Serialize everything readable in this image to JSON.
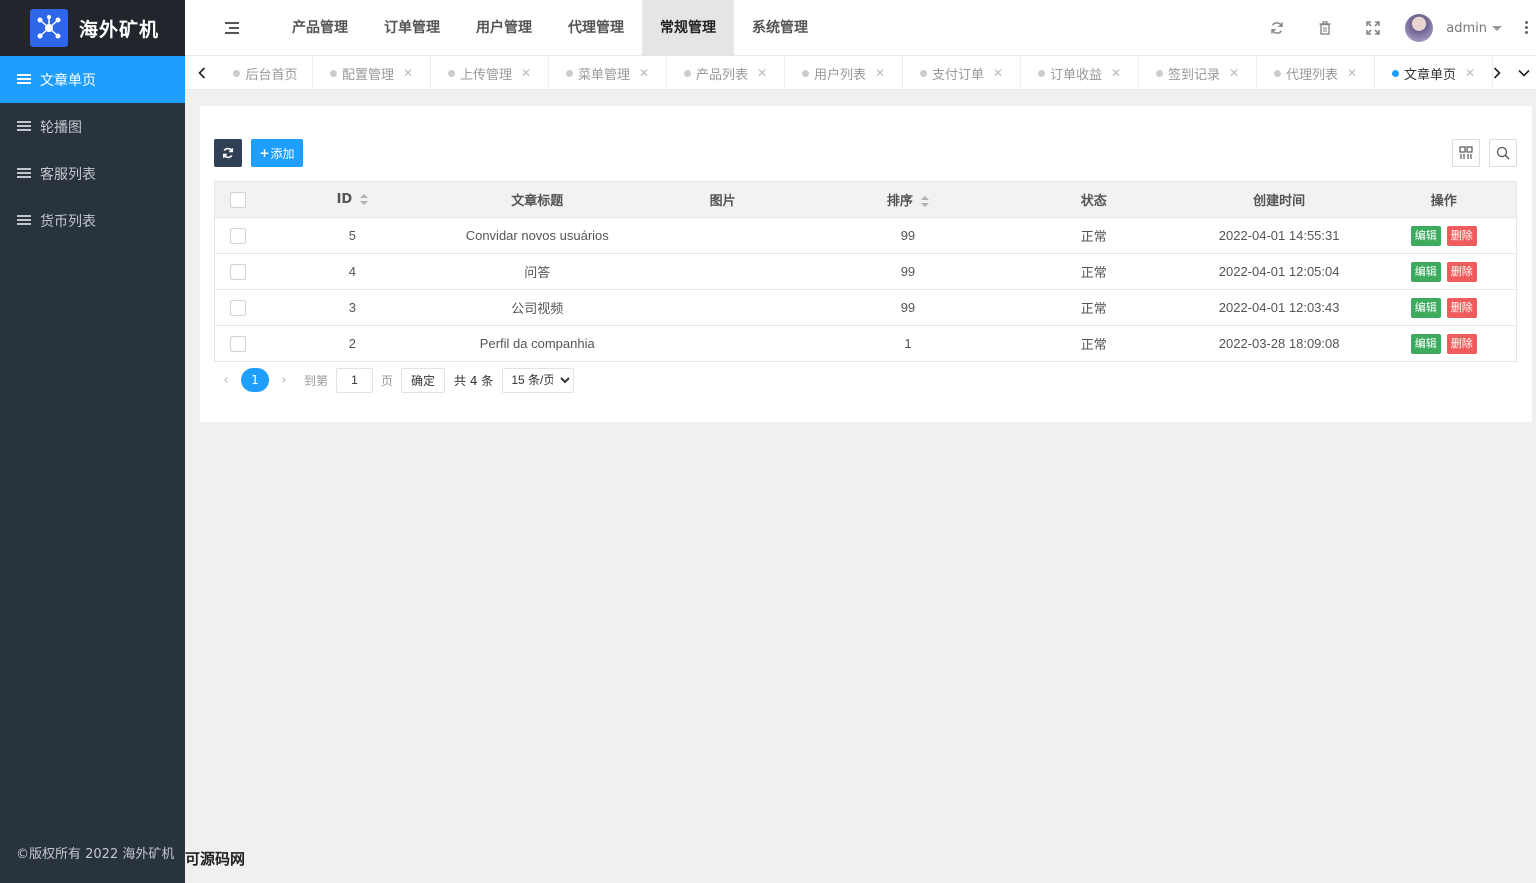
{
  "app": {
    "title": "海外矿机"
  },
  "sidebar": {
    "items": [
      {
        "label": "文章单页",
        "active": true
      },
      {
        "label": "轮播图"
      },
      {
        "label": "客服列表"
      },
      {
        "label": "货币列表"
      }
    ],
    "copyright": "©版权所有 2022 海外矿机"
  },
  "watermark": "可源码网",
  "header": {
    "nav": [
      {
        "label": "产品管理"
      },
      {
        "label": "订单管理"
      },
      {
        "label": "用户管理"
      },
      {
        "label": "代理管理"
      },
      {
        "label": "常规管理",
        "active": true
      },
      {
        "label": "系统管理"
      }
    ],
    "user": "admin",
    "icons": [
      "refresh-icon",
      "trash-icon",
      "fullscreen-icon"
    ]
  },
  "tabs": [
    {
      "label": "后台首页"
    },
    {
      "label": "配置管理"
    },
    {
      "label": "上传管理"
    },
    {
      "label": "菜单管理"
    },
    {
      "label": "产品列表"
    },
    {
      "label": "用户列表"
    },
    {
      "label": "支付订单"
    },
    {
      "label": "订单收益"
    },
    {
      "label": "签到记录"
    },
    {
      "label": "代理列表"
    },
    {
      "label": "文章单页",
      "active": true
    }
  ],
  "toolbar": {
    "add_label": "添加"
  },
  "table": {
    "headers": [
      "ID",
      "文章标题",
      "图片",
      "排序",
      "状态",
      "创建时间",
      "操作"
    ],
    "rows": [
      {
        "id": "5",
        "title": "Convidar novos usuários",
        "image": "",
        "sort": "99",
        "status": "正常",
        "created": "2022-04-01 14:55:31"
      },
      {
        "id": "4",
        "title": "问答",
        "image": "",
        "sort": "99",
        "status": "正常",
        "created": "2022-04-01 12:05:04"
      },
      {
        "id": "3",
        "title": "公司视频",
        "image": "",
        "sort": "99",
        "status": "正常",
        "created": "2022-04-01 12:03:43"
      },
      {
        "id": "2",
        "title": "Perfil da companhia",
        "image": "",
        "sort": "1",
        "status": "正常",
        "created": "2022-03-28 18:09:08"
      }
    ],
    "edit_label": "编辑",
    "delete_label": "删除"
  },
  "pager": {
    "current": "1",
    "goto_label": "到第",
    "page_value": "1",
    "page_unit": "页",
    "confirm_label": "确定",
    "total": "共 4 条",
    "per_page": "15 条/页"
  },
  "colors": {
    "accent": "#1e9fff",
    "sidebar": "#28333e",
    "edit": "#3eaa5e",
    "delete": "#f05b5b"
  }
}
